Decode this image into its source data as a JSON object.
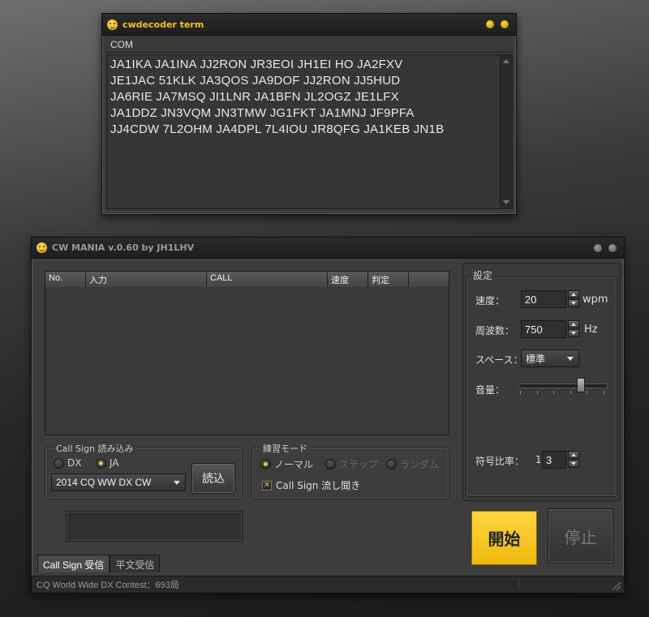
{
  "terminal": {
    "title": "cwdecoder term",
    "menu": [
      "COM"
    ],
    "lines": [
      "JA1IKA  JA1INA  JJ2RON  JR3EOI  JH1EI  HO  JA2FXV",
      "JE1JAC   51KLK  JA3QOS  JA9DOF  JJ2RON  JJ5HUD",
      "JA6RIE  JA7MSQ  JI1LNR  JA1BFN  JL2OGZ  JE1LFX",
      "JA1DDZ  JN3VQM  JN3TMW  JG1FKT  JA1MNJ  JF9PFA",
      "JJ4CDW 7L2OHM  JA4DPL  7L4IOU  JR8QFG  JA1KEB  JN1B"
    ]
  },
  "main": {
    "title": "CW MANIA v.0.60 by JH1LHV",
    "grid_columns": [
      "No.",
      "入力",
      "CALL",
      "速度",
      "判定",
      ""
    ],
    "callsign_group": {
      "label": "Call Sign 読み込み",
      "radios": [
        {
          "label": "DX",
          "checked": false
        },
        {
          "label": "JA",
          "checked": true
        }
      ],
      "contest_select": "2014 CQ WW DX CW",
      "load_button": "読込"
    },
    "practice_group": {
      "label": "練習モード",
      "radios": [
        {
          "label": "ノーマル",
          "checked": true,
          "enabled": true
        },
        {
          "label": "ステップ",
          "checked": false,
          "enabled": false
        },
        {
          "label": "ランダム",
          "checked": false,
          "enabled": false
        }
      ],
      "stream_check": {
        "label": "Call Sign 流し聞き",
        "checked": true,
        "mark": "✕"
      }
    },
    "settings": {
      "title": "設定",
      "speed_label": "速度：",
      "speed_value": "20",
      "speed_unit": "wpm",
      "freq_label": "周波数：",
      "freq_value": "750",
      "freq_unit": "Hz",
      "space_label": "スペース：",
      "space_value": "標準",
      "volume_label": "音量：",
      "volume_level": 0.72,
      "ratio_label": "符号比率：",
      "ratio_prefix": "1",
      "ratio_value": "3"
    },
    "start_button": "開始",
    "stop_button": "停止",
    "tabs": [
      {
        "label": "Call Sign 受信",
        "active": true
      },
      {
        "label": "平文受信",
        "active": false
      }
    ],
    "status": "CQ World Wide DX Contest：693局"
  },
  "colors": {
    "accent": "#f3c225",
    "start_button": "#f7c628"
  }
}
